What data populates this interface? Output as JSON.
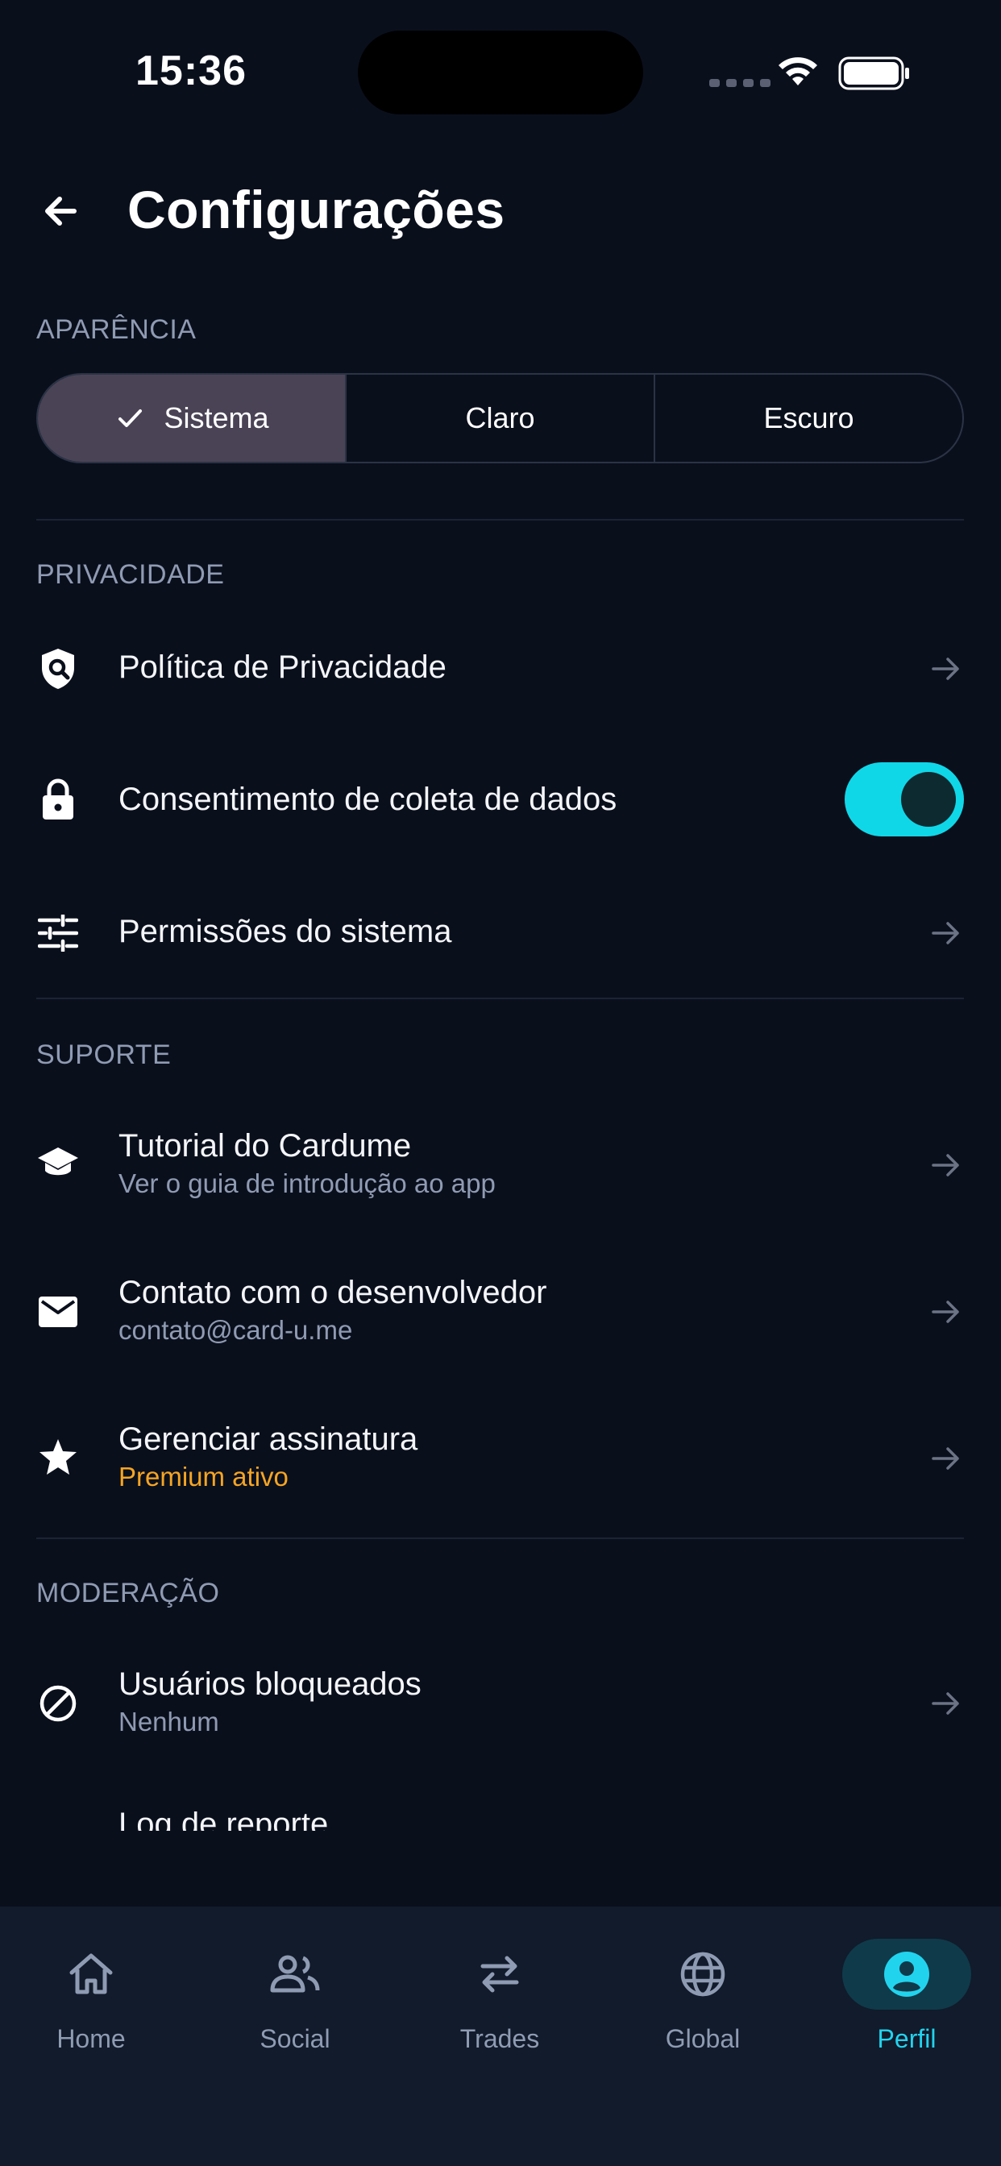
{
  "status_bar": {
    "time": "15:36"
  },
  "header": {
    "title": "Configurações"
  },
  "appearance": {
    "section": "APARÊNCIA",
    "options": [
      "Sistema",
      "Claro",
      "Escuro"
    ],
    "selected": "Sistema"
  },
  "privacy": {
    "section": "PRIVACIDADE",
    "items": [
      {
        "icon": "shield-search-icon",
        "title": "Política de Privacidade"
      },
      {
        "icon": "lock-icon",
        "title": "Consentimento de coleta de dados",
        "toggle": true
      },
      {
        "icon": "sliders-icon",
        "title": "Permissões do sistema"
      }
    ]
  },
  "support": {
    "section": "SUPORTE",
    "items": [
      {
        "icon": "graduation-cap-icon",
        "title": "Tutorial do Cardume",
        "subtitle": "Ver o guia de introdução ao app"
      },
      {
        "icon": "mail-icon",
        "title": "Contato com o desenvolvedor",
        "subtitle": "contato@card-u.me"
      },
      {
        "icon": "star-icon",
        "title": "Gerenciar assinatura",
        "subtitle": "Premium ativo"
      }
    ]
  },
  "moderation": {
    "section": "MODERAÇÃO",
    "items": [
      {
        "icon": "block-icon",
        "title": "Usuários bloqueados",
        "subtitle": "Nenhum"
      },
      {
        "title": "Log de reporte"
      }
    ]
  },
  "nav": {
    "items": [
      {
        "label": "Home",
        "icon": "home-icon"
      },
      {
        "label": "Social",
        "icon": "people-icon"
      },
      {
        "label": "Trades",
        "icon": "swap-icon"
      },
      {
        "label": "Global",
        "icon": "globe-icon"
      },
      {
        "label": "Perfil",
        "icon": "profile-icon",
        "active": true
      }
    ]
  },
  "colors": {
    "background": "#0a0f1c",
    "accent": "#10d7e8",
    "premium": "#f5a524",
    "muted": "#8f9bb3"
  }
}
